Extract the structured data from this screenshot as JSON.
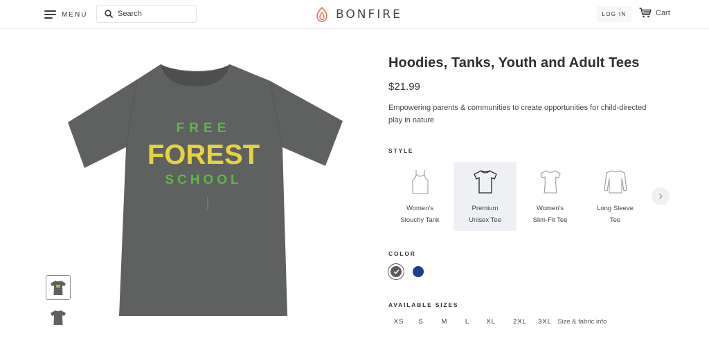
{
  "header": {
    "menu_label": "MENU",
    "search_placeholder": "Search",
    "brand": "BONFIRE",
    "login_label": "LOG IN",
    "cart_label": "Cart"
  },
  "product": {
    "title": "Hoodies, Tanks, Youth and Adult Tees",
    "price": "$21.99",
    "description": "Empowering parents & communities to create opportunities for child-directed play in nature",
    "design_lines": [
      "FREE",
      "FOREST",
      "SCHOOL"
    ]
  },
  "style": {
    "label": "STYLE",
    "options": [
      {
        "line1": "Women's",
        "line2": "Slouchy Tank",
        "icon": "tank-top-icon",
        "selected": false
      },
      {
        "line1": "Premium",
        "line2": "Unisex Tee",
        "icon": "tee-icon",
        "selected": true
      },
      {
        "line1": "Women's",
        "line2": "Slim-Fit Tee",
        "icon": "slim-tee-icon",
        "selected": false
      },
      {
        "line1": "Long Sleeve",
        "line2": "Tee",
        "icon": "long-sleeve-icon",
        "selected": false
      }
    ]
  },
  "color": {
    "label": "COLOR",
    "options": [
      {
        "name": "heather-gray",
        "hex": "#5a5a5a",
        "selected": true
      },
      {
        "name": "navy",
        "hex": "#1f3d8f",
        "selected": false
      }
    ]
  },
  "sizes": {
    "label": "AVAILABLE SIZES",
    "options": [
      "XS",
      "S",
      "M",
      "L",
      "XL",
      "2XL",
      "3XL"
    ],
    "info_link": "Size & fabric info"
  },
  "colors": {
    "shirt": "#5e6160",
    "accent_logo": "#e8735a",
    "text_dark": "#2e2e2e"
  }
}
